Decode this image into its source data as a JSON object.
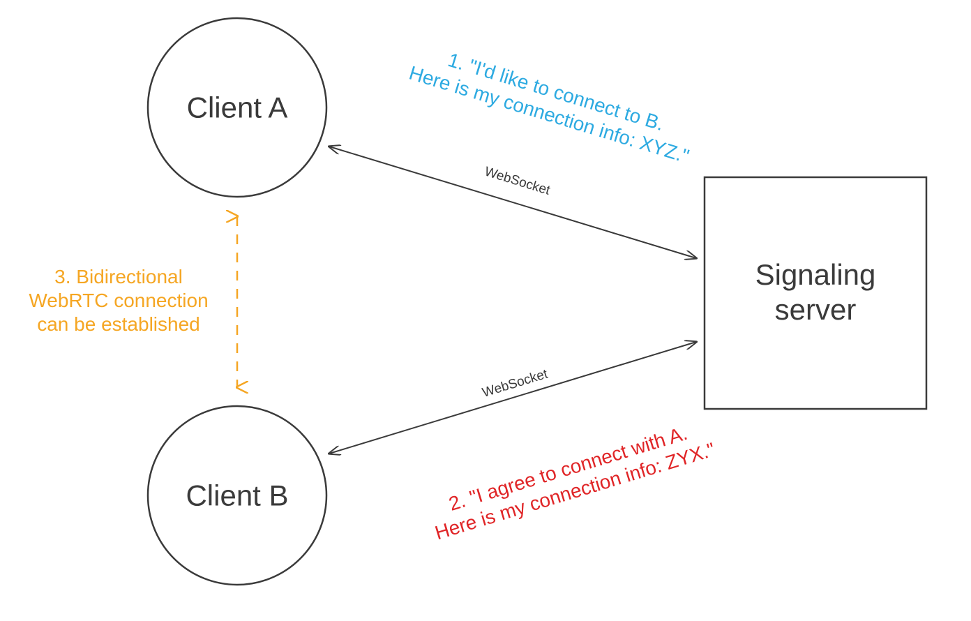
{
  "nodes": {
    "clientA": "Client A",
    "clientB": "Client B",
    "server_line1": "Signaling",
    "server_line2": "server"
  },
  "edges": {
    "ws_a": "WebSocket",
    "ws_b": "WebSocket"
  },
  "annotations": {
    "step1_line1": "1. \"I'd like to connect to B.",
    "step1_line2": "Here is my connection info: XYZ.\"",
    "step2_line1": "2. \"I agree to connect with A.",
    "step2_line2": "Here is my connection info: ZYX.\"",
    "step3_line1": "3. Bidirectional",
    "step3_line2": "WebRTC connection",
    "step3_line3": "can be established"
  },
  "colors": {
    "stroke_dark": "#3a3a3a",
    "text_dark": "#3a3a3a",
    "blue": "#2daae1",
    "red": "#e02527",
    "orange": "#f5a623"
  }
}
